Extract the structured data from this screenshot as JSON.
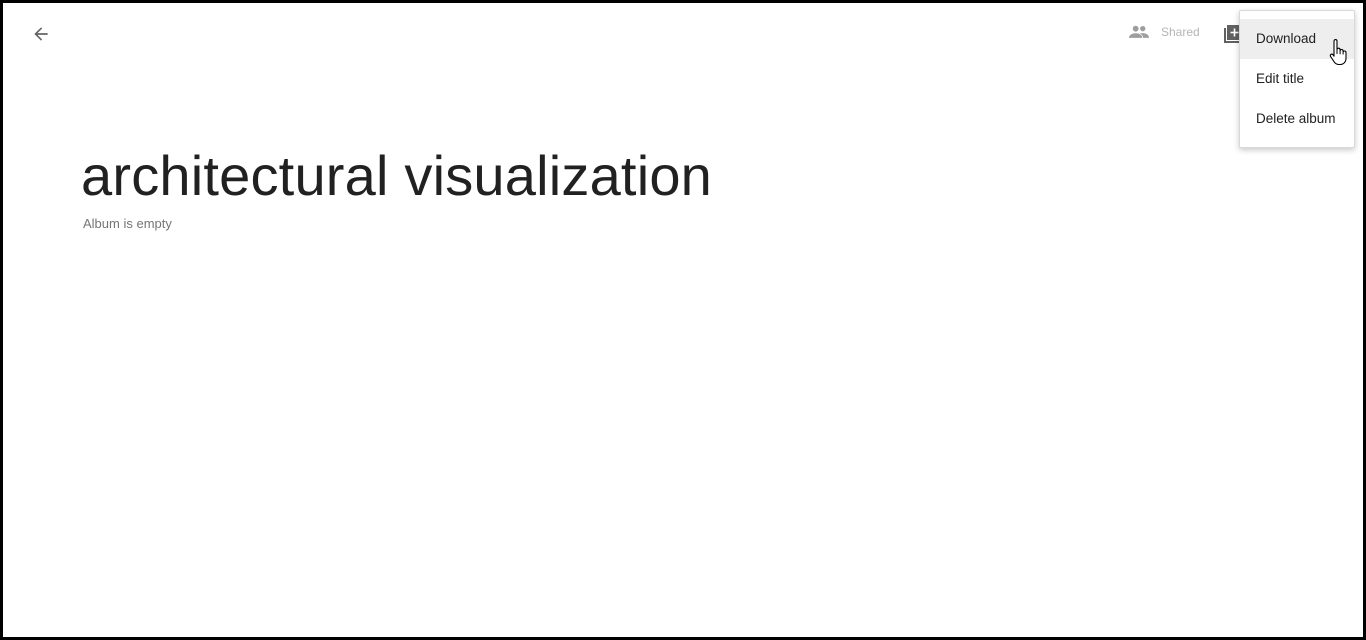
{
  "header": {
    "back_icon": "arrow-left-icon",
    "shared_icon": "people-icon",
    "shared_label": "Shared",
    "add_photo_icon": "add-photo-icon"
  },
  "album": {
    "title": "architectural visualization",
    "subtitle": "Album is empty"
  },
  "menu": {
    "items": [
      {
        "label": "Download",
        "highlighted": true
      },
      {
        "label": "Edit title",
        "highlighted": false
      },
      {
        "label": "Delete album",
        "highlighted": false
      }
    ]
  },
  "colors": {
    "title_text": "#212121",
    "muted_text": "#757575",
    "shared_text": "#b5b5b5",
    "menu_highlight": "#eeeeee"
  }
}
